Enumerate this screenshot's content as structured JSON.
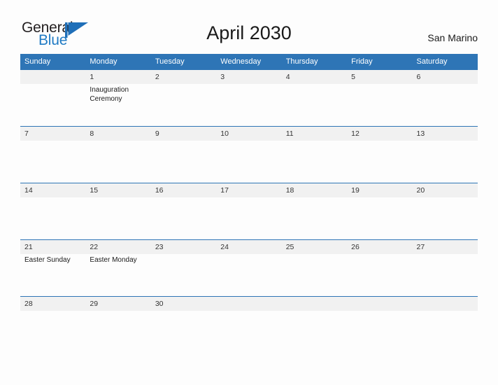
{
  "brand": {
    "word_one": "General",
    "word_two": "Blue",
    "flag_icon": "blue-flag-triangle-icon",
    "color_dark": "#231f20",
    "color_blue": "#1f7ac4"
  },
  "header": {
    "title": "April 2030",
    "location": "San Marino"
  },
  "theme": {
    "header_blue": "#2e75b6",
    "daynum_band": "#f1f1f1",
    "page_bg": "#fdfdfd",
    "text": "#1a1a1a"
  },
  "calendar": {
    "weekday_headers": [
      "Sunday",
      "Monday",
      "Tuesday",
      "Wednesday",
      "Thursday",
      "Friday",
      "Saturday"
    ],
    "weeks": [
      [
        {
          "day": "",
          "events": []
        },
        {
          "day": "1",
          "events": [
            "Inauguration Ceremony"
          ]
        },
        {
          "day": "2",
          "events": []
        },
        {
          "day": "3",
          "events": []
        },
        {
          "day": "4",
          "events": []
        },
        {
          "day": "5",
          "events": []
        },
        {
          "day": "6",
          "events": []
        }
      ],
      [
        {
          "day": "7",
          "events": []
        },
        {
          "day": "8",
          "events": []
        },
        {
          "day": "9",
          "events": []
        },
        {
          "day": "10",
          "events": []
        },
        {
          "day": "11",
          "events": []
        },
        {
          "day": "12",
          "events": []
        },
        {
          "day": "13",
          "events": []
        }
      ],
      [
        {
          "day": "14",
          "events": []
        },
        {
          "day": "15",
          "events": []
        },
        {
          "day": "16",
          "events": []
        },
        {
          "day": "17",
          "events": []
        },
        {
          "day": "18",
          "events": []
        },
        {
          "day": "19",
          "events": []
        },
        {
          "day": "20",
          "events": []
        }
      ],
      [
        {
          "day": "21",
          "events": [
            "Easter Sunday"
          ]
        },
        {
          "day": "22",
          "events": [
            "Easter Monday"
          ]
        },
        {
          "day": "23",
          "events": []
        },
        {
          "day": "24",
          "events": []
        },
        {
          "day": "25",
          "events": []
        },
        {
          "day": "26",
          "events": []
        },
        {
          "day": "27",
          "events": []
        }
      ],
      [
        {
          "day": "28",
          "events": []
        },
        {
          "day": "29",
          "events": []
        },
        {
          "day": "30",
          "events": []
        },
        {
          "day": "",
          "events": []
        },
        {
          "day": "",
          "events": []
        },
        {
          "day": "",
          "events": []
        },
        {
          "day": "",
          "events": []
        }
      ]
    ]
  }
}
